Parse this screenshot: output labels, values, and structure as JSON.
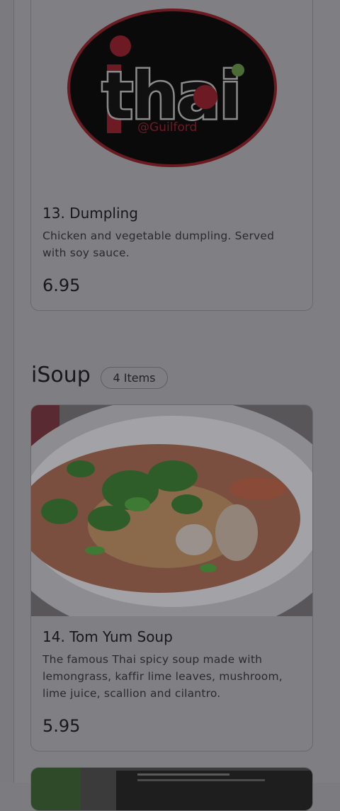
{
  "menu": {
    "items": [
      {
        "name": "13. Dumpling",
        "description": "Chicken and vegetable dumpling. Served with soy sauce.",
        "price": "6.95",
        "image": "ithai-guilford-logo"
      },
      {
        "name": "14. Tom Yum Soup",
        "description": "The famous Thai spicy soup made with lemongrass, kaffir lime leaves, mushroom, lime juice, scallion and cilantro.",
        "price": "5.95",
        "image": "tom-yum-soup-photo"
      }
    ],
    "section": {
      "title": "iSoup",
      "count": "4 Items"
    }
  },
  "logo": {
    "wordmark": "thai",
    "location": "@Guilford"
  },
  "colors": {
    "overlay": "#7f7f83",
    "logo_red": "#c8102e",
    "logo_black": "#050505",
    "logo_green": "#7ac142"
  }
}
